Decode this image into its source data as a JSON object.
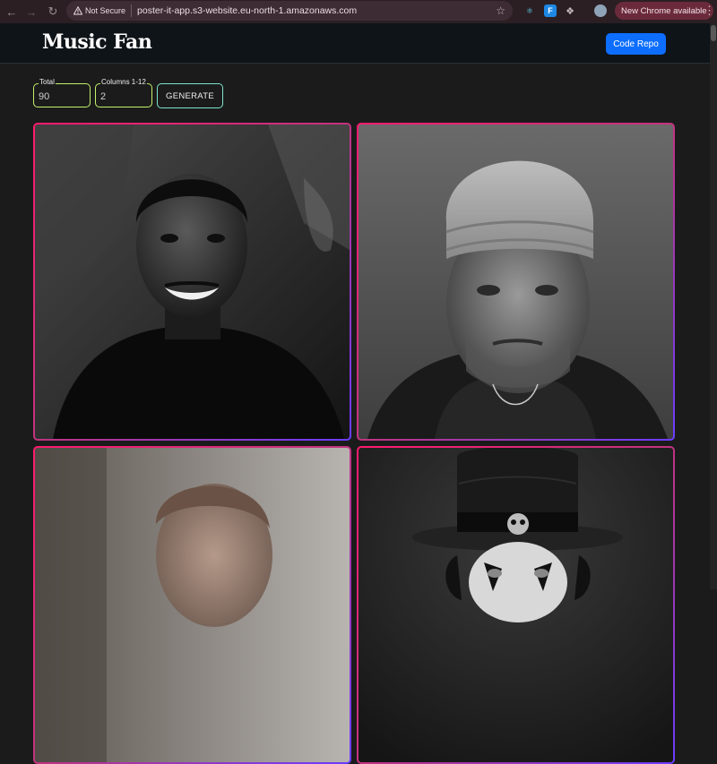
{
  "browser": {
    "security_label": "Not Secure",
    "url": "poster-it-app.s3-website.eu-north-1.amazonaws.com",
    "update_label": "New Chrome available"
  },
  "app": {
    "title": "Music Fan",
    "repo_button": "Code Repo"
  },
  "controls": {
    "total_label": "Total",
    "total_value": "90",
    "columns_label": "Columns 1-12",
    "columns_value": "2",
    "generate_label": "GENERATE"
  },
  "colors": {
    "accent_blue": "#0d6efd",
    "total_border": "#c4f06b",
    "generate_border": "#7ee3c9",
    "card_gradient_start": "#ff1a6e",
    "card_gradient_end": "#6a3cff"
  },
  "posters": [
    {
      "subject": "smiling-man-portrait"
    },
    {
      "subject": "man-in-knit-beanie-portrait"
    },
    {
      "subject": "man-looking-down-portrait"
    },
    {
      "subject": "man-in-top-hat-skull-band-portrait"
    }
  ]
}
